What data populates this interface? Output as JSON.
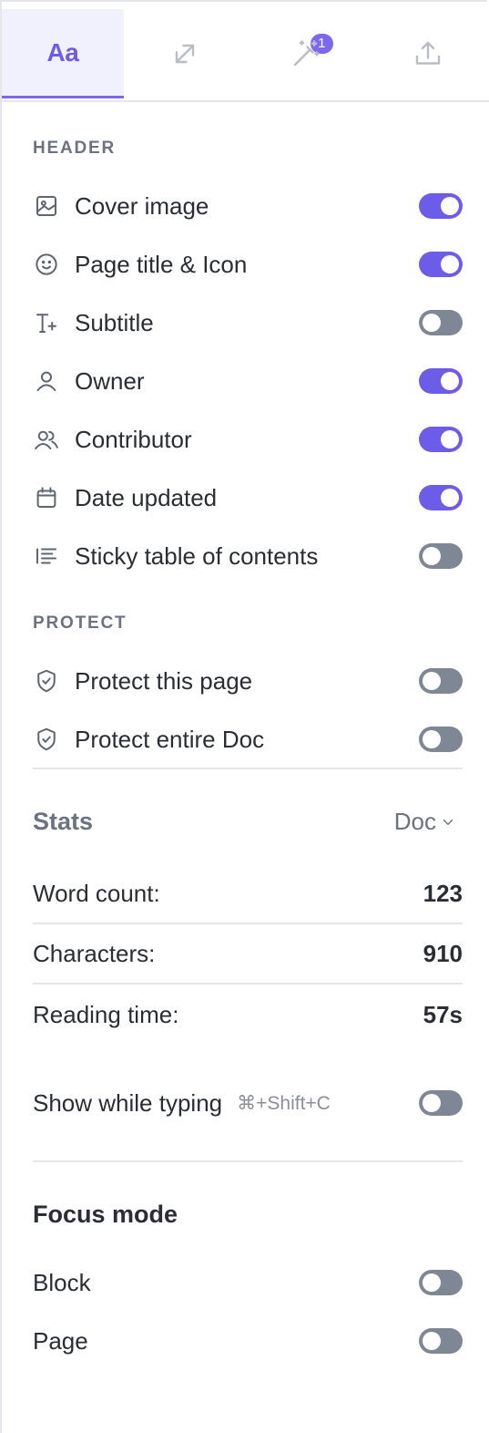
{
  "tabs": [
    {
      "name": "format",
      "label": "Aa",
      "active": true
    },
    {
      "name": "relationships",
      "icon": "arrows-diagonal-icon",
      "badge": "1"
    },
    {
      "name": "ai",
      "icon": "magic-wand-icon"
    },
    {
      "name": "export",
      "icon": "upload-icon"
    }
  ],
  "header": {
    "section_label": "HEADER",
    "items": [
      {
        "label": "Cover image",
        "icon": "image-icon",
        "on": true
      },
      {
        "label": "Page title & Icon",
        "icon": "smiley-icon",
        "on": true
      },
      {
        "label": "Subtitle",
        "icon": "text-plus-icon",
        "on": false
      },
      {
        "label": "Owner",
        "icon": "user-icon",
        "on": true
      },
      {
        "label": "Contributor",
        "icon": "users-icon",
        "on": true
      },
      {
        "label": "Date updated",
        "icon": "calendar-icon",
        "on": true
      },
      {
        "label": "Sticky table of contents",
        "icon": "list-icon",
        "on": false
      }
    ]
  },
  "protect": {
    "section_label": "PROTECT",
    "items": [
      {
        "label": "Protect this page",
        "icon": "shield-check-icon",
        "on": false
      },
      {
        "label": "Protect entire Doc",
        "icon": "shield-check-icon",
        "on": false
      }
    ]
  },
  "stats": {
    "title": "Stats",
    "scope": "Doc",
    "rows": [
      {
        "label": "Word count:",
        "value": "123"
      },
      {
        "label": "Characters:",
        "value": "910"
      },
      {
        "label": "Reading time:",
        "value": "57s"
      }
    ],
    "show_while_typing": {
      "label": "Show while typing",
      "shortcut": "⌘+Shift+C",
      "on": false
    }
  },
  "focus_mode": {
    "title": "Focus mode",
    "items": [
      {
        "label": "Block",
        "on": false
      },
      {
        "label": "Page",
        "on": false
      }
    ]
  },
  "colors": {
    "accent": "#6d5ce8",
    "toggle_off": "#7f8694",
    "border": "#e4e6eb"
  }
}
